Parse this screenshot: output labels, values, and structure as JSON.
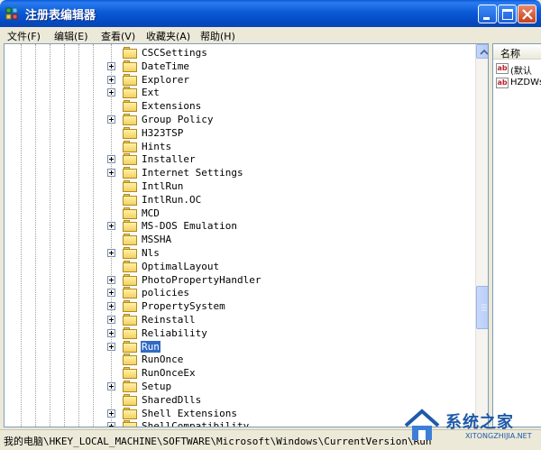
{
  "window": {
    "title": "注册表编辑器"
  },
  "menu": [
    {
      "label": "文件(F)"
    },
    {
      "label": "编辑(E)"
    },
    {
      "label": "查看(V)"
    },
    {
      "label": "收藏夹(A)"
    },
    {
      "label": "帮助(H)"
    }
  ],
  "tree": {
    "items": [
      {
        "label": "CSCSettings",
        "expandable": false,
        "selected": false
      },
      {
        "label": "DateTime",
        "expandable": true,
        "selected": false
      },
      {
        "label": "Explorer",
        "expandable": true,
        "selected": false
      },
      {
        "label": "Ext",
        "expandable": true,
        "selected": false
      },
      {
        "label": "Extensions",
        "expandable": false,
        "selected": false
      },
      {
        "label": "Group Policy",
        "expandable": true,
        "selected": false
      },
      {
        "label": "H323TSP",
        "expandable": false,
        "selected": false
      },
      {
        "label": "Hints",
        "expandable": false,
        "selected": false
      },
      {
        "label": "Installer",
        "expandable": true,
        "selected": false
      },
      {
        "label": "Internet Settings",
        "expandable": true,
        "selected": false
      },
      {
        "label": "IntlRun",
        "expandable": false,
        "selected": false
      },
      {
        "label": "IntlRun.OC",
        "expandable": false,
        "selected": false
      },
      {
        "label": "MCD",
        "expandable": false,
        "selected": false
      },
      {
        "label": "MS-DOS Emulation",
        "expandable": true,
        "selected": false
      },
      {
        "label": "MSSHA",
        "expandable": false,
        "selected": false
      },
      {
        "label": "Nls",
        "expandable": true,
        "selected": false
      },
      {
        "label": "OptimalLayout",
        "expandable": false,
        "selected": false
      },
      {
        "label": "PhotoPropertyHandler",
        "expandable": true,
        "selected": false
      },
      {
        "label": "policies",
        "expandable": true,
        "selected": false
      },
      {
        "label": "PropertySystem",
        "expandable": true,
        "selected": false
      },
      {
        "label": "Reinstall",
        "expandable": true,
        "selected": false
      },
      {
        "label": "Reliability",
        "expandable": true,
        "selected": false
      },
      {
        "label": "Run",
        "expandable": true,
        "selected": true
      },
      {
        "label": "RunOnce",
        "expandable": false,
        "selected": false
      },
      {
        "label": "RunOnceEx",
        "expandable": false,
        "selected": false
      },
      {
        "label": "Setup",
        "expandable": true,
        "selected": false
      },
      {
        "label": "SharedDlls",
        "expandable": false,
        "selected": false
      },
      {
        "label": "Shell Extensions",
        "expandable": true,
        "selected": false
      },
      {
        "label": "ShellCompatibility",
        "expandable": true,
        "selected": false
      }
    ]
  },
  "list": {
    "header": "名称",
    "items": [
      {
        "icon": "ab",
        "label": "(默认"
      },
      {
        "icon": "ab",
        "label": "HZDWs"
      }
    ]
  },
  "status": {
    "path": "我的电脑\\HKEY_LOCAL_MACHINE\\SOFTWARE\\Microsoft\\Windows\\CurrentVersion\\Run"
  },
  "watermark": {
    "title": "系统之家",
    "subtitle": "XITONGZHIJIA.NET"
  },
  "icons": {
    "app": "registry-editor-icon",
    "minimize": "minimize-icon",
    "maximize": "maximize-icon",
    "close": "close-icon",
    "folder": "folder-icon",
    "value": "string-value-icon"
  },
  "colors": {
    "titlebar": "#0a5ad6",
    "selection": "#316ac5",
    "folder": "#f4d060"
  }
}
